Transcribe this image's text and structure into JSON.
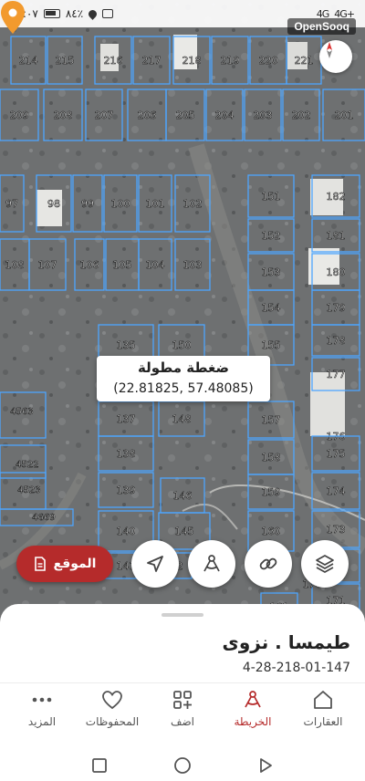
{
  "status_bar": {
    "time": "١٥:٠٧",
    "battery": "٨٤٪",
    "signal_left": "4G",
    "signal_right": "4G+"
  },
  "map": {
    "brand_badge": "OpenSooq",
    "watermark": "السوق المفتوح",
    "tooltip": {
      "title": "ضغطة مطولة",
      "coords": "(22.81825, 57.48085)"
    },
    "selected_plot": "147",
    "plot_labels": [
      "214",
      "215",
      "216",
      "217",
      "218",
      "219",
      "220",
      "221",
      "209",
      "208",
      "207",
      "206",
      "205",
      "204",
      "203",
      "202",
      "201",
      "97",
      "98",
      "99",
      "100",
      "101",
      "102",
      "151",
      "182",
      "108",
      "107",
      "106",
      "105",
      "104",
      "103",
      "152",
      "181",
      "153",
      "180",
      "154",
      "179",
      "135",
      "150",
      "155",
      "178",
      "177",
      "4563",
      "137",
      "148",
      "157",
      "176",
      "138",
      "158",
      "175",
      "4522",
      "139",
      "146",
      "159",
      "174",
      "4523",
      "4669",
      "140",
      "145",
      "160",
      "173",
      "141",
      "142",
      "172",
      "171",
      "170",
      "161"
    ]
  },
  "actions": {
    "location_button": "الموقع",
    "icons": [
      "navigate-icon",
      "measure-icon",
      "link-icon",
      "layers-icon"
    ]
  },
  "sheet": {
    "place_name": "طيمسا . نزوى",
    "plot_number": "4-28-218-01-147"
  },
  "bottom_nav": [
    {
      "label": "المزيد",
      "icon": "more-icon",
      "active": false
    },
    {
      "label": "المحفوظات",
      "icon": "heart-icon",
      "active": false
    },
    {
      "label": "اضف",
      "icon": "add-icon",
      "active": false
    },
    {
      "label": "الخريطة",
      "icon": "map-icon",
      "active": true
    },
    {
      "label": "العقارات",
      "icon": "home-icon",
      "active": false
    }
  ],
  "colors": {
    "accent": "#b52b2b",
    "parcel_line": "#4da6ff",
    "pin": "#f29a2e"
  }
}
